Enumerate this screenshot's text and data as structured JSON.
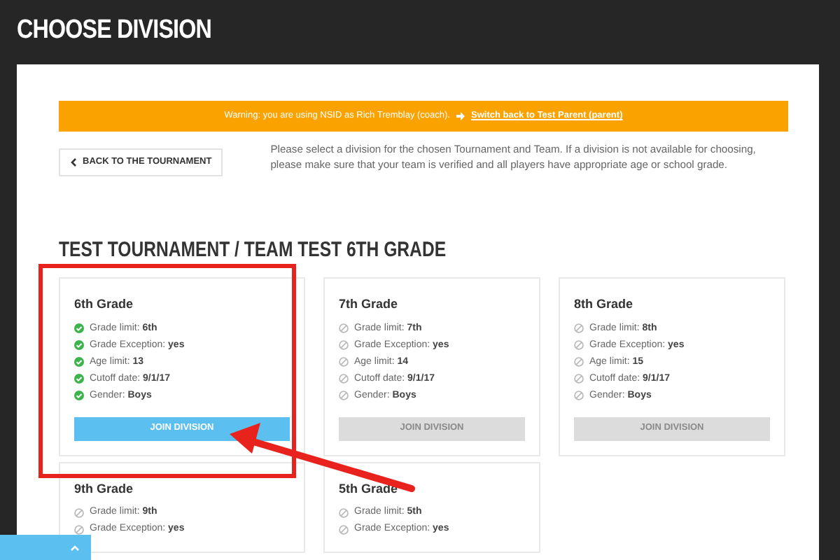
{
  "page_title": "CHOOSE DIVISION",
  "warning": {
    "text": "Warning: you are using NSID as Rich Tremblay (coach).",
    "link": "Switch back to Test Parent (parent)"
  },
  "back_button": "BACK TO THE TOURNAMENT",
  "instructions": "Please select a division for the chosen Tournament and Team. If a division is not available for choosing, please make sure that your team is verified and all players have appropriate age or school grade.",
  "section_title": "TEST TOURNAMENT / TEAM TEST 6TH GRADE",
  "divisions": [
    {
      "name": "6th Grade",
      "items": [
        {
          "text": "Grade limit: **6th**",
          "met": true
        },
        {
          "text": "Grade Exception: **yes**",
          "met": true
        },
        {
          "text": "Age limit: **13**",
          "met": true
        },
        {
          "text": "Cutoff date: **9/1/17**",
          "met": true
        },
        {
          "text": "Gender: **Boys**",
          "met": true
        }
      ],
      "button": "JOIN DIVISION",
      "disabled": false
    },
    {
      "name": "7th Grade",
      "items": [
        {
          "text": "Grade limit: **7th**",
          "met": false
        },
        {
          "text": "Grade Exception: **yes**",
          "met": false
        },
        {
          "text": "Age limit: **14**",
          "met": false
        },
        {
          "text": "Cutoff date: **9/1/17**",
          "met": false
        },
        {
          "text": "Gender: **Boys**",
          "met": false
        }
      ],
      "button": "JOIN DIVISION",
      "disabled": true
    },
    {
      "name": "8th Grade",
      "items": [
        {
          "text": "Grade limit: **8th**",
          "met": false
        },
        {
          "text": "Grade Exception: **yes**",
          "met": false
        },
        {
          "text": "Age limit: **15**",
          "met": false
        },
        {
          "text": "Cutoff date: **9/1/17**",
          "met": false
        },
        {
          "text": "Gender: **Boys**",
          "met": false
        }
      ],
      "button": "JOIN DIVISION",
      "disabled": true
    },
    {
      "name": "9th Grade",
      "items": [
        {
          "text": "Grade limit: **9th**",
          "met": false
        },
        {
          "text": "Grade Exception: **yes**",
          "met": false
        }
      ]
    },
    {
      "name": "5th Grade",
      "items": [
        {
          "text": "Grade limit: **5th**",
          "met": false
        },
        {
          "text": "Grade Exception: **yes**",
          "met": false
        }
      ]
    }
  ]
}
